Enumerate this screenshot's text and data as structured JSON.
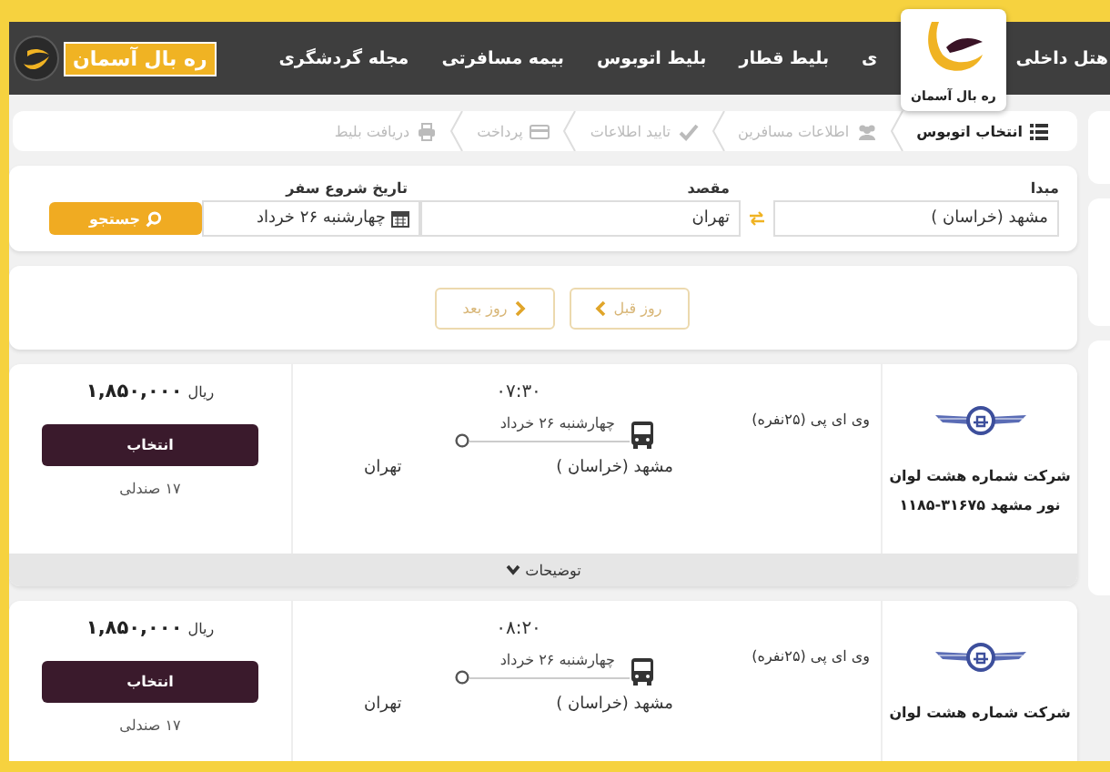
{
  "header": {
    "brand": "ره بال آسمان",
    "nav": [
      "هتل داخلی",
      "ی",
      "بلیط قطار",
      "بلیط اتوبوس",
      "بیمه مسافرتی",
      "مجله گردشگری"
    ]
  },
  "overlay_logo": {
    "caption": "ره بال آسمان"
  },
  "steps": [
    {
      "label": "انتخاب اتوبوس",
      "selected": true
    },
    {
      "label": "اطلاعات مسافرین",
      "selected": false
    },
    {
      "label": "تایید اطلاعات",
      "selected": false
    },
    {
      "label": "پرداخت",
      "selected": false
    },
    {
      "label": "دریافت بلیط",
      "selected": false
    }
  ],
  "search": {
    "origin_label": "مبدا",
    "origin": "مشهد (خراسان )",
    "destination_label": "مقصد",
    "destination": "تهران",
    "date_label": "تاریخ شروع سفر",
    "date": "چهارشنبه ۲۶ خرداد",
    "button": "جستجو"
  },
  "day_nav": [
    "روز قبل",
    "روز بعد"
  ],
  "trips": [
    {
      "company_lines": [
        "شرکت شماره هشت لوان",
        "نور مشهد ۳۱۶۷۵-۱۱۸۵"
      ],
      "bus_type": "وی ای پی (۲۵نفره)",
      "time": "۰۷:۳۰",
      "date": "چهارشنبه ۲۶ خرداد",
      "from": "مشهد (خراسان )",
      "to": "تهران",
      "price": "۱,۸۵۰,۰۰۰",
      "currency": "ریال",
      "button": "انتخاب",
      "seats": "۱۷ صندلی",
      "details": "توضیحات"
    },
    {
      "company_lines": [
        "شرکت شماره هشت لوان"
      ],
      "bus_type": "وی ای پی (۲۵نفره)",
      "time": "۰۸:۲۰",
      "date": "چهارشنبه ۲۶ خرداد",
      "from": "مشهد (خراسان )",
      "to": "تهران",
      "price": "۱,۸۵۰,۰۰۰",
      "currency": "ریال",
      "button": "انتخاب",
      "seats": "۱۷ صندلی"
    }
  ]
}
